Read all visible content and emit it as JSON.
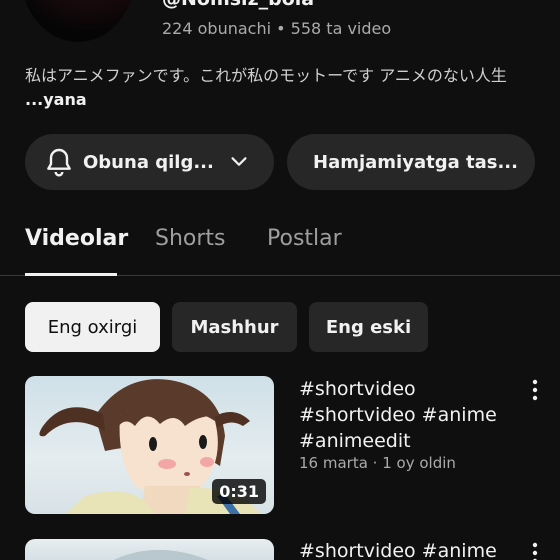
{
  "channel": {
    "handle": "@Nomsiz_bola",
    "subscribers": "224 obunachi",
    "separator": "•",
    "videos": "558 ta video",
    "description": "私はアニメファンです。これが私のモットーです アニメのない人生",
    "more_label": "...yana"
  },
  "actions": {
    "subscribe_label": "Obuna qilg...",
    "community_label": "Hamjamiyatga tas..."
  },
  "tabs": [
    {
      "label": "Videolar",
      "active": true
    },
    {
      "label": "Shorts",
      "active": false
    },
    {
      "label": "Postlar",
      "active": false
    }
  ],
  "filters": [
    {
      "label": "Eng oxirgi",
      "active": true
    },
    {
      "label": "Mashhur",
      "active": false
    },
    {
      "label": "Eng eski",
      "active": false
    }
  ],
  "videos": [
    {
      "title": "#shortvideo #shortvideo #anime #animeedit",
      "duration": "0:31",
      "views": "16 marta",
      "age": "1 oy oldin"
    },
    {
      "title": "#shortvideo #anime"
    }
  ],
  "icons": {
    "subscribe": "bell-icon",
    "subscribe_dropdown": "chevron-down-icon",
    "video_menu": "more-vert-icon"
  },
  "colors": {
    "background": "#0f0f0f",
    "surface": "#272727",
    "text_primary": "#f1f1f1",
    "text_secondary": "#aaaaaa",
    "chip_active_bg": "#f1f1f1"
  }
}
